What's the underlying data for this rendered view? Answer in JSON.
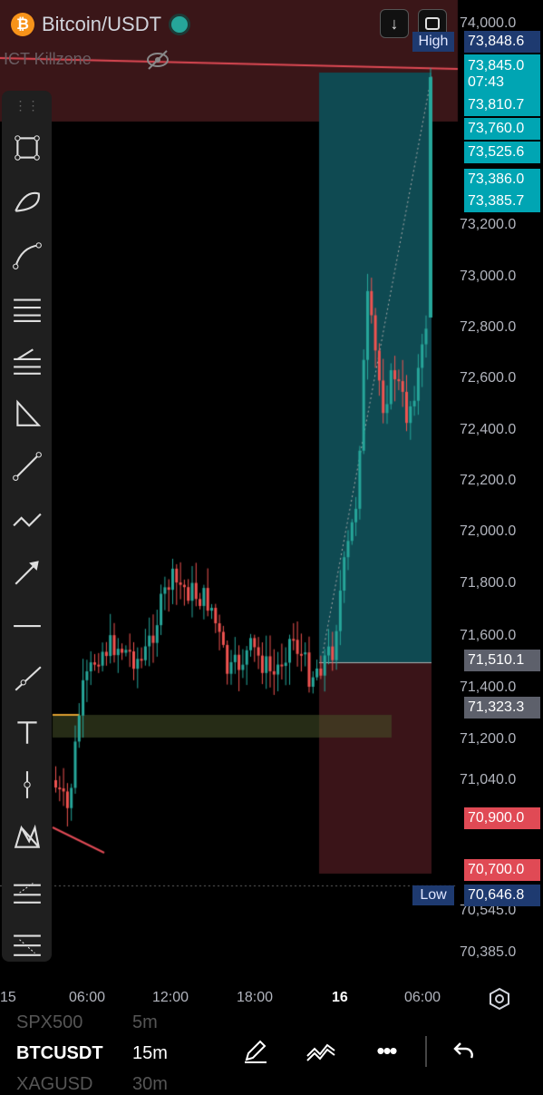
{
  "header": {
    "symbol": "Bitcoin/USDT",
    "coin_glyph": "₿",
    "indicator": "ICT Killzone",
    "icons": [
      "download-icon",
      "fullscreen-icon",
      "eye-hidden-icon"
    ]
  },
  "chart_data": {
    "type": "candlestick",
    "y_ticks": [
      "74,000.0",
      "73,200.0",
      "73,000.0",
      "72,800.0",
      "72,600.0",
      "72,400.0",
      "72,200.0",
      "72,000.0",
      "71,800.0",
      "71,600.0",
      "71,400.0",
      "71,200.0",
      "71,040.0",
      "70,545.0",
      "70,385.0"
    ],
    "x_ticks": [
      "15",
      "06:00",
      "12:00",
      "18:00",
      "16",
      "06:00"
    ],
    "ylim": [
      70385,
      74000
    ],
    "price_tags": [
      {
        "label": "High",
        "value": "73,848.6",
        "style": "navy"
      },
      {
        "value": "73,845.0",
        "sub": "07:43",
        "style": "teal"
      },
      {
        "value": "73,810.7",
        "style": "teal"
      },
      {
        "value": "73,760.0",
        "style": "teal"
      },
      {
        "value": "73,525.6",
        "style": "teal"
      },
      {
        "value": "73,386.0",
        "style": "teal"
      },
      {
        "value": "73,385.7",
        "style": "teal"
      },
      {
        "value": "71,510.1",
        "style": "gray"
      },
      {
        "value": "71,323.3",
        "style": "gray"
      },
      {
        "value": "70,900.0",
        "style": "red"
      },
      {
        "value": "70,700.0",
        "style": "red"
      },
      {
        "label": "Low",
        "value": "70,646.8",
        "style": "navy"
      }
    ],
    "colors": {
      "up": "#26a69a",
      "down": "#ef5350",
      "position_profit": "#0f4a52",
      "position_loss": "#3a1418",
      "killzone": "#3a1618"
    }
  },
  "toolbar": {
    "tools": [
      "rectangle-icon",
      "arc-icon",
      "curve-icon",
      "horizontal-lines-icon",
      "fib-retracement-icon",
      "triangle-icon",
      "trend-line-icon",
      "polyline-icon",
      "arrow-icon",
      "horizontal-line-icon",
      "ray-icon",
      "text-icon",
      "vertical-line-icon",
      "xabcd-pattern-icon",
      "fib-extension-icon",
      "long-short-icon"
    ]
  },
  "watchlist": [
    {
      "symbol": "SPX500",
      "interval": "5m"
    },
    {
      "symbol": "BTCUSDT",
      "interval": "15m"
    },
    {
      "symbol": "XAGUSD",
      "interval": "30m"
    }
  ],
  "bottom_actions": [
    "pencil-icon",
    "drawing-tools-icon",
    "more-icon",
    "undo-icon"
  ]
}
